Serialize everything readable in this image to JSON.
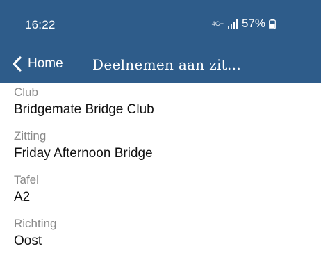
{
  "status_bar": {
    "time": "16:22",
    "network": "4G+",
    "battery": "57%"
  },
  "appbar": {
    "back_label": "Home",
    "title": "Deelnemen aan zit..."
  },
  "fields": [
    {
      "label": "Club",
      "value": "Bridgemate Bridge Club"
    },
    {
      "label": "Zitting",
      "value": "Friday Afternoon Bridge"
    },
    {
      "label": "Tafel",
      "value": "A2"
    },
    {
      "label": "Richting",
      "value": "Oost"
    }
  ],
  "colors": {
    "header": "#2e5c8a",
    "label": "#8a8a8a",
    "value": "#111111"
  },
  "icons": {
    "back": "chevron-left-icon",
    "signal": "signal-bars-icon",
    "battery": "battery-icon"
  }
}
